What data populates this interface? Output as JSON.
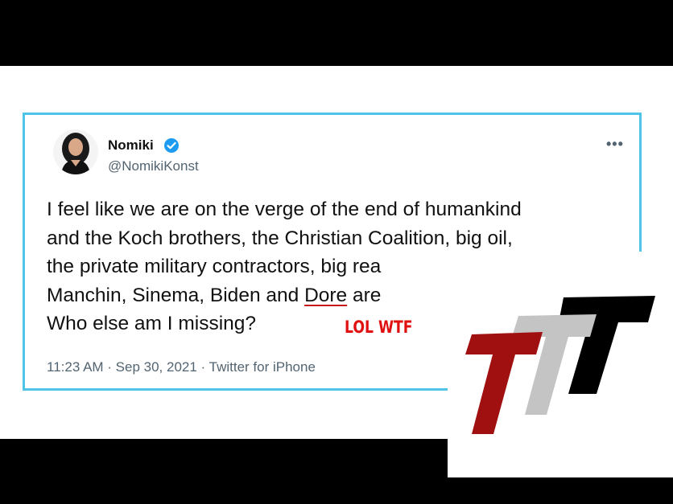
{
  "tweet": {
    "display_name": "Nomiki",
    "handle": "@NomikiKonst",
    "lines": [
      "I feel like we are on the verge of the end of humankind",
      "and the Koch brothers, the Christian Coalition, big oil,",
      "the private military contractors, big rea"
    ],
    "line4_before": "Manchin, Sinema, Biden and ",
    "line4_highlight": "Dore",
    "line4_after": " are",
    "line5": "Who else am I missing?",
    "timestamp": "11:23 AM · Sep 30, 2021 · Twitter for iPhone",
    "more_icon": "•••",
    "verified_badge_color": "#1d9bf0"
  },
  "annotation": {
    "text": "LOL WTF",
    "color": "#e01010"
  },
  "logo": {
    "name": "TTT",
    "colors": [
      "#a01010",
      "#c4c4c4",
      "#000000"
    ]
  }
}
